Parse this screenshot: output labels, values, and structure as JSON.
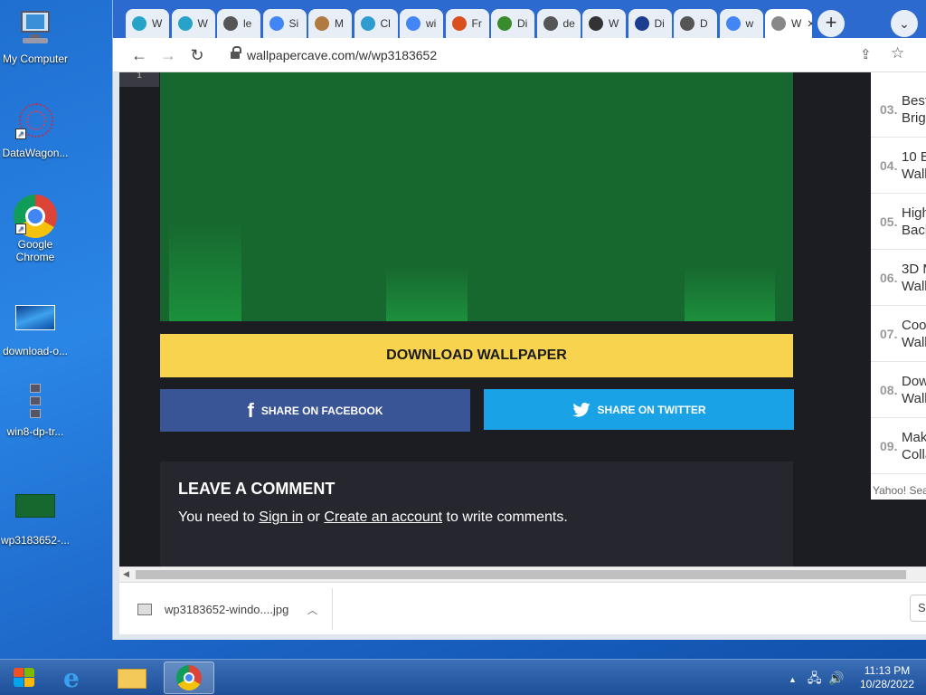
{
  "desktop": {
    "icons": [
      {
        "label": "My Computer"
      },
      {
        "label": "DataWagon..."
      },
      {
        "label": "Google Chrome"
      },
      {
        "label": "download-o..."
      },
      {
        "label": "win8-dp-tr..."
      },
      {
        "label": "wp3183652-..."
      }
    ]
  },
  "browser": {
    "tabs": [
      {
        "title": "W",
        "icon": "globe-icon",
        "color": "#27a3c9"
      },
      {
        "title": "W",
        "icon": "globe-icon",
        "color": "#27a3c9"
      },
      {
        "title": "le",
        "icon": "globe-icon",
        "color": "#555555"
      },
      {
        "title": "Si",
        "icon": "google-icon",
        "color": "#4285f4"
      },
      {
        "title": "M",
        "icon": "site-icon",
        "color": "#b07a40"
      },
      {
        "title": "Cl",
        "icon": "site-icon",
        "color": "#2e9ccf"
      },
      {
        "title": "wi",
        "icon": "google-icon",
        "color": "#4285f4"
      },
      {
        "title": "Fr",
        "icon": "site-icon",
        "color": "#d9501e"
      },
      {
        "title": "Di",
        "icon": "site-icon",
        "color": "#3a8a2e"
      },
      {
        "title": "de",
        "icon": "globe-icon",
        "color": "#555555"
      },
      {
        "title": "W",
        "icon": "site-icon",
        "color": "#333333"
      },
      {
        "title": "Di",
        "icon": "site-icon",
        "color": "#1c3d8f"
      },
      {
        "title": "D",
        "icon": "download-icon",
        "color": "#555555"
      },
      {
        "title": "w",
        "icon": "google-icon",
        "color": "#4285f4"
      },
      {
        "title": "W",
        "icon": "wallpapercave-icon",
        "color": "#888888",
        "active": true
      }
    ],
    "new_tab_label": "+",
    "url": "wallpapercave.com/w/wp3183652"
  },
  "page": {
    "page_number": "1",
    "download_label": "DOWNLOAD WALLPAPER",
    "share_facebook_label": "SHARE ON FACEBOOK",
    "share_twitter_label": "SHARE ON TWITTER",
    "comment_title": "LEAVE A COMMENT",
    "comment_prefix": "You need to ",
    "sign_in_label": "Sign in",
    "comment_or": " or ",
    "create_account_label": "Create an account",
    "comment_suffix": " to write comments.",
    "sidebar_items": [
      {
        "num": "03.",
        "text_line1": "Best",
        "text_line2": "Brig"
      },
      {
        "num": "04.",
        "text_line1": "10 B",
        "text_line2": "Wall"
      },
      {
        "num": "05.",
        "text_line1": "High",
        "text_line2": "Back"
      },
      {
        "num": "06.",
        "text_line1": "3D M",
        "text_line2": "Wall"
      },
      {
        "num": "07.",
        "text_line1": "Cool",
        "text_line2": "Wall"
      },
      {
        "num": "08.",
        "text_line1": "Dow",
        "text_line2": "Wall"
      },
      {
        "num": "09.",
        "text_line1": "Mak",
        "text_line2": "Colla"
      }
    ],
    "yahoo_text": "Yahoo! Sea"
  },
  "downloads": {
    "file_name": "wp3183652-windo....jpg",
    "show_all_label": "S"
  },
  "taskbar": {
    "time": "11:13 PM",
    "date": "10/28/2022"
  }
}
